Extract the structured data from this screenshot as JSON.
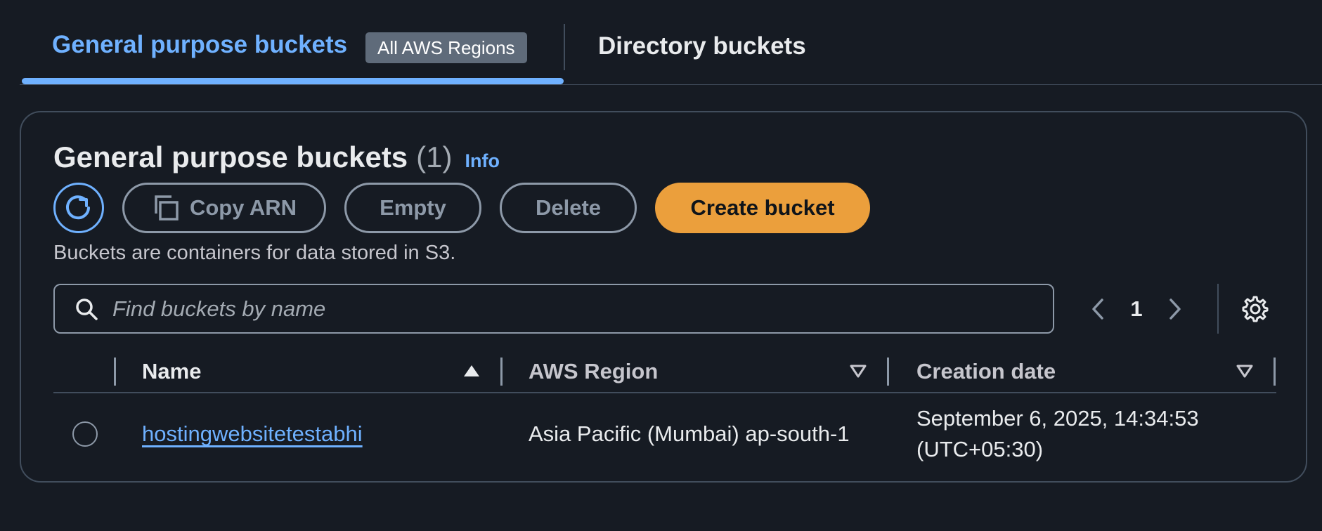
{
  "tabs": {
    "general_label": "General purpose buckets",
    "regions_badge": "All AWS Regions",
    "directory_label": "Directory buckets"
  },
  "panel": {
    "title": "General purpose buckets",
    "count": "(1)",
    "info": "Info",
    "description": "Buckets are containers for data stored in S3."
  },
  "toolbar": {
    "refresh_icon": "refresh-icon",
    "copy_arn_label": "Copy ARN",
    "empty_label": "Empty",
    "delete_label": "Delete",
    "create_label": "Create bucket"
  },
  "search": {
    "placeholder": "Find buckets by name",
    "value": ""
  },
  "pagination": {
    "current_page": "1"
  },
  "table": {
    "columns": [
      {
        "label": "Name",
        "sort": "ascending"
      },
      {
        "label": "AWS Region",
        "sort": "none"
      },
      {
        "label": "Creation date",
        "sort": "none"
      }
    ],
    "rows": [
      {
        "name": "hostingwebsitetestabhi",
        "region": "Asia Pacific (Mumbai) ap-south-1",
        "created": "September 6, 2025, 14:34:53 (UTC+05:30)"
      }
    ]
  },
  "colors": {
    "background": "#161b23",
    "accent": "#6fb1ff",
    "primary_button": "#eb9f3c",
    "border": "#414d5c"
  }
}
